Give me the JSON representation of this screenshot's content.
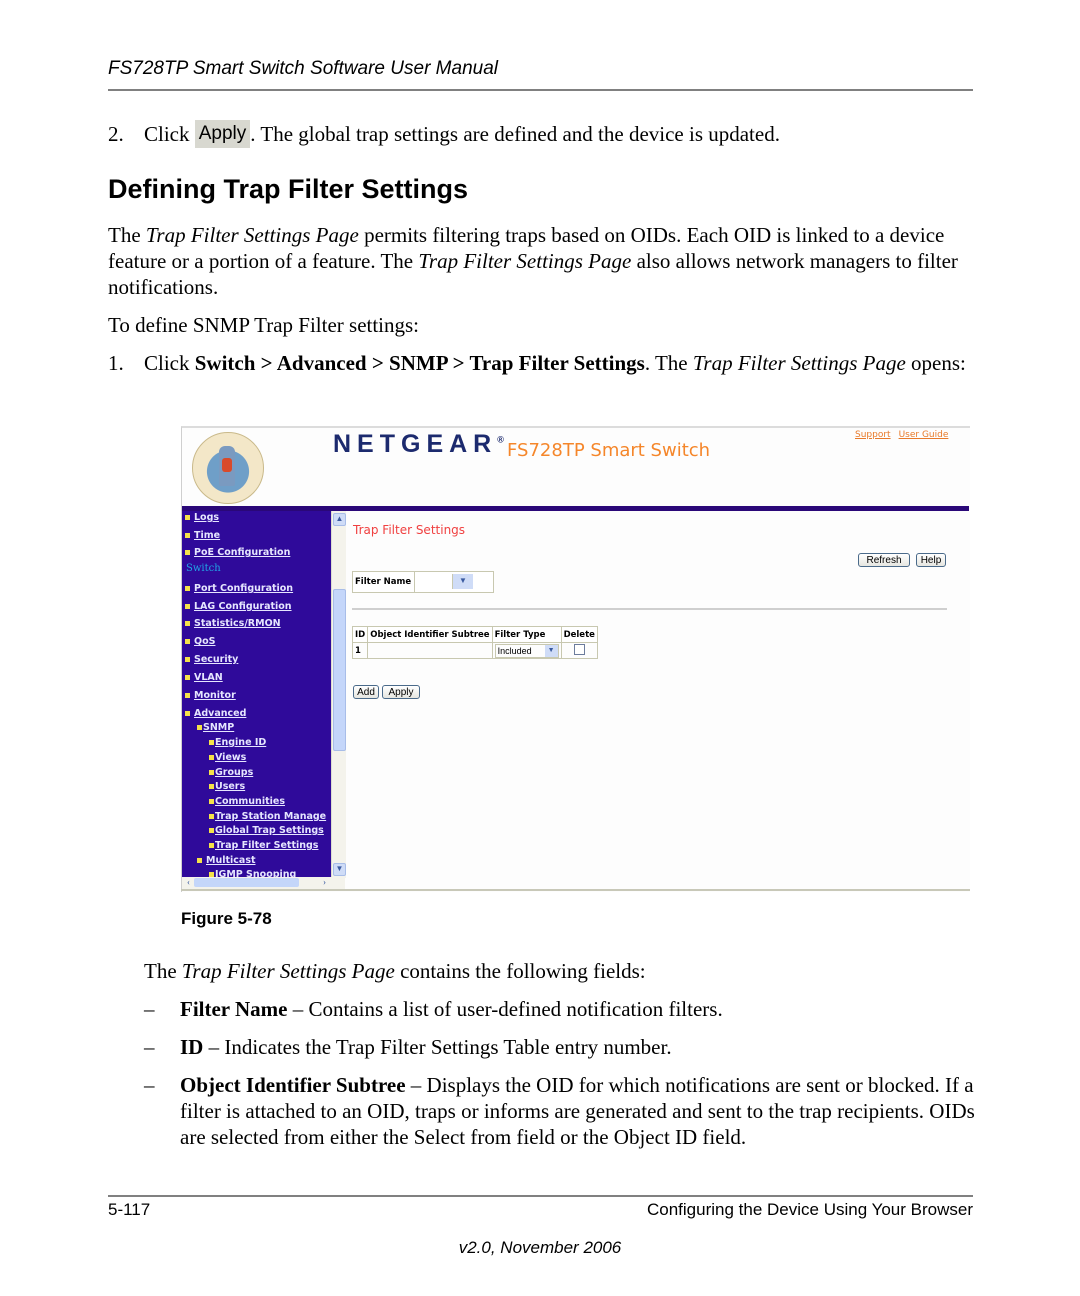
{
  "header": {
    "running_title": "FS728TP Smart Switch Software User Manual"
  },
  "step2": {
    "number": "2.",
    "click": "Click",
    "button_label": "Apply",
    "text": ". The global trap settings are defined and the device is updated."
  },
  "section": {
    "title": "Defining Trap Filter Settings"
  },
  "intro": {
    "p1_a": "The ",
    "p1_em1": "Trap Filter Settings Page",
    "p1_b": " permits filtering traps based on OIDs. Each OID is linked to a device feature or a portion of a feature. The ",
    "p1_em2": "Trap Filter Settings Page",
    "p1_c": " also allows network managers to filter notifications.",
    "p2": "To define SNMP Trap Filter settings:"
  },
  "step1": {
    "number": "1.",
    "click": "Click ",
    "path": "Switch > Advanced > SNMP > Trap Filter Settings",
    "mid": ". The ",
    "em": "Trap Filter Settings Page",
    "end": " opens:"
  },
  "screenshot": {
    "brand": "NETGEAR",
    "brand_mark": "®",
    "product": "FS728TP Smart Switch",
    "links": [
      "Support",
      "User Guide"
    ],
    "nav": {
      "top_items": [
        "Logs",
        "Time",
        "PoE Configuration"
      ],
      "section_label": "Switch",
      "switch_items": [
        "Port Configuration",
        "LAG Configuration",
        "Statistics/RMON",
        "QoS",
        "Security",
        "VLAN",
        "Monitor",
        "Advanced"
      ],
      "advanced_sub": "SNMP",
      "snmp_items": [
        "Engine ID",
        "Views",
        "Groups",
        "Users",
        "Communities",
        "Trap Station Manage",
        "Global Trap Settings",
        "Trap Filter Settings"
      ],
      "after_items": [
        "Multicast"
      ],
      "multicast_sub": [
        "IGMP Snooping"
      ]
    },
    "page_title": "Trap Filter Settings",
    "buttons": {
      "refresh": "Refresh",
      "help": "Help",
      "add": "Add",
      "apply": "Apply"
    },
    "filter_name": {
      "label": "Filter Name",
      "value": ""
    },
    "table": {
      "columns": [
        "ID",
        "Object Identifier Subtree",
        "Filter Type",
        "Delete"
      ],
      "rows": [
        {
          "id": "1",
          "oid": "",
          "filter_type": "Included",
          "delete": false
        }
      ]
    }
  },
  "figure": {
    "caption": "Figure 5-78"
  },
  "fields_intro": {
    "a": "The ",
    "em": "Trap Filter Settings Page",
    "b": " contains the following fields:"
  },
  "fields": [
    {
      "dash": "–",
      "term": "Filter Name",
      "desc": " – Contains a list of user-defined notification filters."
    },
    {
      "dash": "–",
      "term": "ID",
      "desc": " – Indicates the Trap Filter Settings Table entry number."
    },
    {
      "dash": "–",
      "term": "Object Identifier Subtree",
      "desc": " – Displays the OID for which notifications are sent or blocked. If a filter is attached to an OID, traps or informs are generated and sent to the trap recipients. OIDs are selected from either the Select from field or the Object ID field."
    }
  ],
  "footer": {
    "page": "5-117",
    "chapter": "Configuring the Device Using Your Browser",
    "version": "v2.0, November 2006"
  }
}
